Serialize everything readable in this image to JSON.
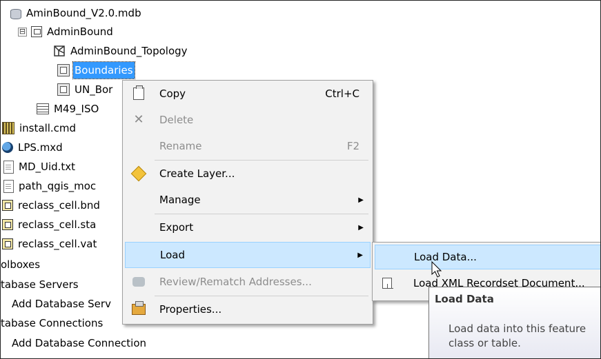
{
  "tree": {
    "items": [
      {
        "label": "AminBound_V2.0.mdb",
        "icon": "database-icon"
      },
      {
        "label": "AdminBound",
        "icon": "feature-dataset-icon",
        "expander": "⊟"
      },
      {
        "label": "AdminBound_Topology",
        "icon": "topology-icon"
      },
      {
        "label": "Boundaries",
        "icon": "feature-class-icon"
      },
      {
        "label": "UN_Bor",
        "icon": "feature-class-icon"
      },
      {
        "label": "M49_ISO",
        "icon": "table-icon"
      },
      {
        "label": "install.cmd",
        "icon": "command-file-icon"
      },
      {
        "label": "LPS.mxd",
        "icon": "map-document-icon"
      },
      {
        "label": "MD_Uid.txt",
        "icon": "text-file-icon"
      },
      {
        "label": "path_qgis_moc",
        "icon": "text-file-icon"
      },
      {
        "label": "reclass_cell.bnd",
        "icon": "dbf-table-icon"
      },
      {
        "label": "reclass_cell.sta",
        "icon": "dbf-table-icon"
      },
      {
        "label": "reclass_cell.vat",
        "icon": "dbf-table-icon"
      },
      {
        "label": "olboxes"
      },
      {
        "label": "tabase Servers"
      },
      {
        "label": "Add Database Serv"
      },
      {
        "label": "tabase Connections"
      },
      {
        "label": "Add Database Connection"
      }
    ]
  },
  "context_menu": {
    "items": [
      {
        "label": "Copy",
        "shortcut": "Ctrl+C",
        "icon": "copy-icon"
      },
      {
        "label": "Delete",
        "icon": "delete-icon"
      },
      {
        "label": "Rename",
        "shortcut": "F2"
      },
      {
        "label": "Create Layer...",
        "icon": "create-layer-icon"
      },
      {
        "label": "Manage",
        "submenu_arrow": "▶"
      },
      {
        "label": "Export",
        "submenu_arrow": "▶"
      },
      {
        "label": "Load",
        "submenu_arrow": "▶"
      },
      {
        "label": "Review/Rematch Addresses...",
        "icon": "review-icon"
      },
      {
        "label": "Properties...",
        "icon": "properties-icon"
      }
    ]
  },
  "submenu": {
    "items": [
      {
        "label": "Load Data..."
      },
      {
        "label": "Load XML Recordset Document...",
        "icon": "xml-load-icon"
      }
    ]
  },
  "tooltip": {
    "title": "Load Data",
    "body": "Load data into this feature class or table."
  },
  "colors": {
    "selection": "#3399ff",
    "menu_highlight": "#cce8ff",
    "menu_background": "#f2f2f2"
  }
}
